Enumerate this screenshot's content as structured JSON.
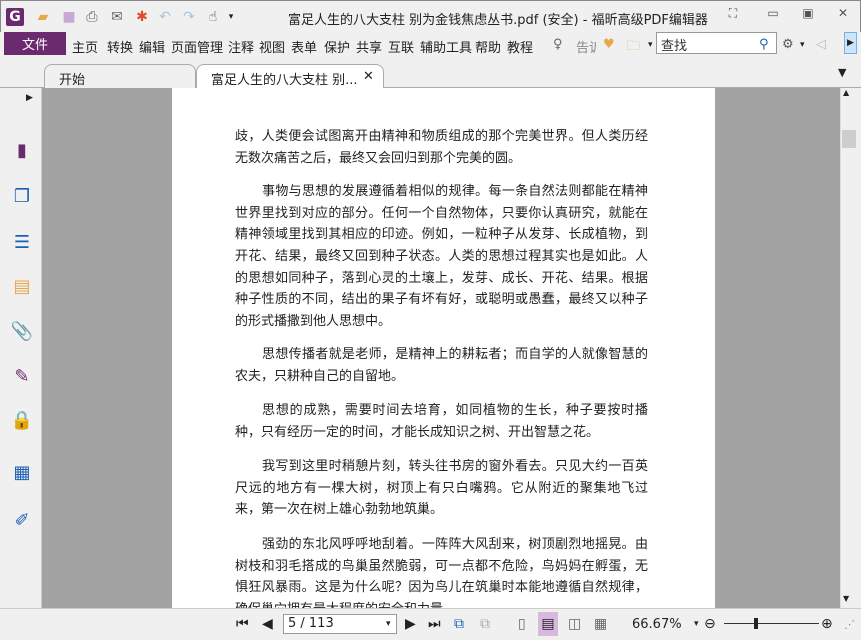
{
  "window": {
    "title": "富足人生的八大支柱 别为金钱焦虑丛书.pdf (安全) - 福昕高级PDF编辑器"
  },
  "menu": {
    "file": "文件",
    "items": [
      "主页",
      "转换",
      "编辑",
      "页面管理",
      "注释",
      "视图",
      "表单",
      "保护",
      "共享",
      "互联",
      "辅助工具",
      "帮助",
      "教程"
    ],
    "tell_me": "告诉",
    "search_placeholder": "查找"
  },
  "tabs": [
    {
      "label": "开始"
    },
    {
      "label": "富足人生的八大支柱 别..."
    }
  ],
  "document": {
    "paragraphs": [
      {
        "indent": false,
        "lines": [
          "歧，人类便会试图离开由精神和物质组成的那个完美世界。但人类历经",
          "无数次痛苦之后，最终又会回归到那个完美的圆。"
        ]
      },
      {
        "indent": true,
        "lines": [
          "事物与思想的发展遵循着相似的规律。每一条自然法则都能在精神",
          "世界里找到对应的部分。任何一个自然物体，只要你认真研究，就能在",
          "精神领域里找到其相应的印迹。例如，一粒种子从发芽、长成植物，到",
          "开花、结果，最终又回到种子状态。人类的思想过程其实也是如此。人",
          "的思想如同种子，落到心灵的土壤上，发芽、成长、开花、结果。根据",
          "种子性质的不同，结出的果子有坏有好，或聪明或愚蠢，最终又以种子",
          "的形式播撒到他人思想中。"
        ]
      },
      {
        "indent": true,
        "lines": [
          "思想传播者就是老师，是精神上的耕耘者；而自学的人就像智慧的",
          "农夫，只耕种自己的自留地。"
        ]
      },
      {
        "indent": true,
        "lines": [
          "思想的成熟，需要时间去培育，如同植物的生长，种子要按时播",
          "种，只有经历一定的时间，才能长成知识之树、开出智慧之花。"
        ]
      },
      {
        "indent": true,
        "lines": [
          "我写到这里时稍憩片刻，转头往书房的窗外看去。只见大约一百英",
          "尺远的地方有一棵大树，树顶上有只白嘴鸦。它从附近的聚集地飞过",
          "来，第一次在树上雄心勃勃地筑巢。"
        ]
      },
      {
        "indent": true,
        "lines": [
          "强劲的东北风呼呼地刮着。一阵阵大风刮来，树顶剧烈地摇晃。由",
          "树枝和羽毛搭成的鸟巢虽然脆弱，可一点都不危险，鸟妈妈在孵蛋，无",
          "惧狂风暴雨。这是为什么呢？因为鸟儿在筑巢时本能地遵循自然规律，",
          "确保巢穴拥有最大程度的安全和力量。"
        ]
      }
    ]
  },
  "status": {
    "page": "5 / 113",
    "zoom": "66.67%"
  },
  "colors": {
    "accent": "#6b2a6e",
    "doc_bg": "#a3a3a3"
  }
}
